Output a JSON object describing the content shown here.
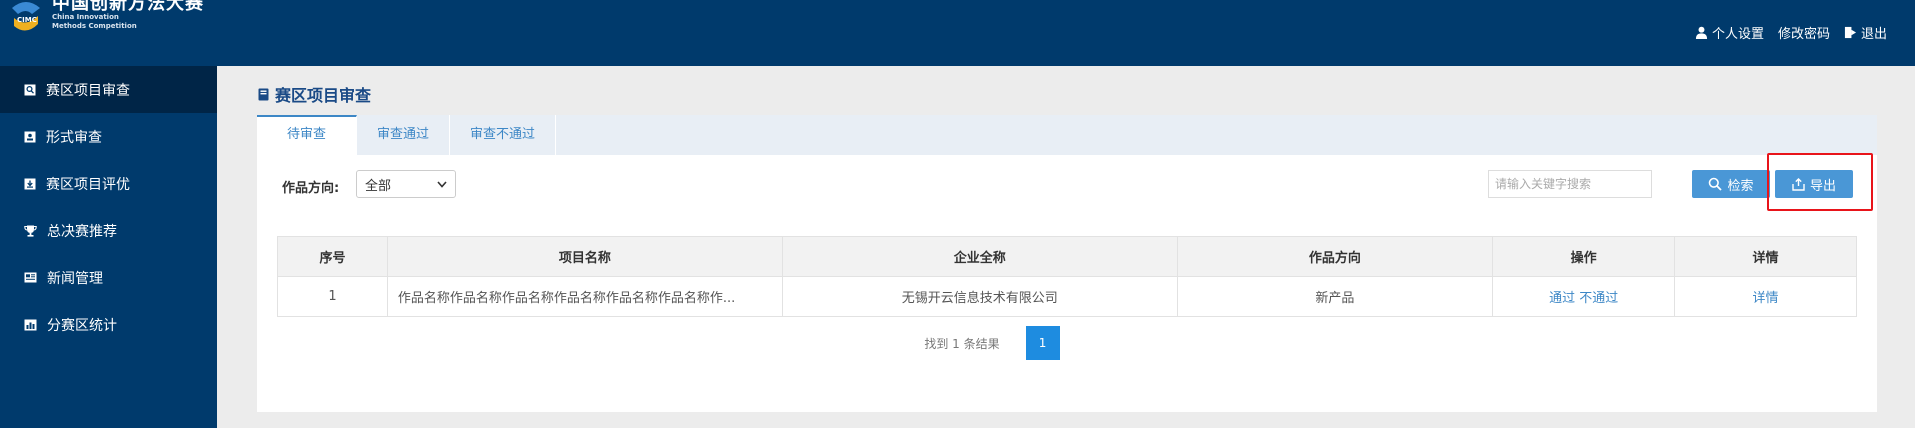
{
  "brand": {
    "cn_name": "中国创新方法大赛",
    "en_line1": "China Innovation",
    "en_line2": "Methods Competition"
  },
  "top_links": {
    "profile": "个人设置",
    "password": "修改密码",
    "logout": "退出"
  },
  "sidebar": {
    "items": [
      {
        "label": "赛区项目审查",
        "icon": "search-doc-icon"
      },
      {
        "label": "形式审查",
        "icon": "id-card-icon"
      },
      {
        "label": "赛区项目评优",
        "icon": "download-box-icon"
      },
      {
        "label": "总决赛推荐",
        "icon": "trophy-icon"
      },
      {
        "label": "新闻管理",
        "icon": "newspaper-icon"
      },
      {
        "label": "分赛区统计",
        "icon": "bar-chart-icon"
      }
    ]
  },
  "page": {
    "title": "赛区项目审查"
  },
  "tabs": [
    {
      "label": "待审查"
    },
    {
      "label": "审查通过"
    },
    {
      "label": "审查不通过"
    }
  ],
  "filter": {
    "label": "作品方向:",
    "selected": "全部"
  },
  "search": {
    "placeholder": "请输入关键字搜索",
    "search_button": "检索",
    "export_button": "导出"
  },
  "table": {
    "headers": [
      "序号",
      "项目名称",
      "企业全称",
      "作品方向",
      "操作",
      "详情"
    ],
    "rows": [
      {
        "index": "1",
        "name": "作品名称作品名称作品名称作品名称作品名称作品名称作...",
        "company": "无锡开云信息技术有限公司",
        "direction": "新产品",
        "action_pass": "通过",
        "action_fail": "不通过",
        "detail": "详情"
      }
    ]
  },
  "pagination": {
    "summary": "找到 1 条结果",
    "current_page": "1"
  },
  "colors": {
    "header_bg": "#003a6c",
    "accent": "#4a97d6",
    "highlight_border": "#e8141a"
  }
}
